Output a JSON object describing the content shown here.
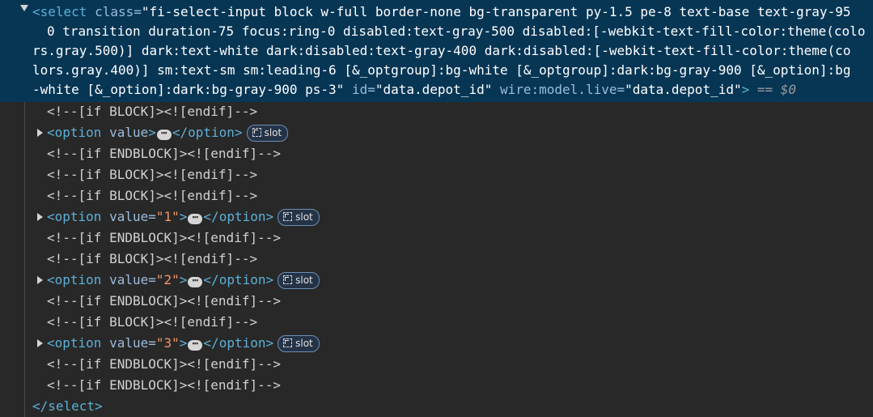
{
  "select_element": {
    "open_tag": "<select",
    "class_attr": " class=",
    "class_lines": [
      "\"fi-select-input block w-full border-none bg-transparent py-1.5 pe-8 text-base text-gray-95",
      "0 transition duration-75 focus:ring-0 disabled:text-gray-500 disabled:[-webkit-text-fill-color:theme(colo",
      "rs.gray.500)] dark:text-white dark:disabled:text-gray-400 dark:disabled:[-webkit-text-fill-color:theme(co",
      "lors.gray.400)] sm:text-sm sm:leading-6 [&_optgroup]:bg-white [&_optgroup]:dark:bg-gray-900 [&_option]:bg",
      "-white [&_option]:dark:bg-gray-900 ps-3\""
    ],
    "id_attr": " id=",
    "id_value": "\"data.depot_id\"",
    "wire_attr": " wire:model.live=",
    "wire_value": "\"data.depot_id\"",
    "close_bracket": ">",
    "selected_ref": " == $0",
    "close_tag": "</select>"
  },
  "comments": {
    "if_block": "<!--[if BLOCK]><![endif]-->",
    "if_endblock": "<!--[if ENDBLOCK]><![endif]-->"
  },
  "option_nodes": [
    {
      "open": "<option",
      "attr": " value",
      "value": "",
      "close": ">",
      "end": "</option>",
      "slot": "slot"
    },
    {
      "open": "<option",
      "attr": " value=",
      "value": "\"1\"",
      "close": ">",
      "end": "</option>",
      "slot": "slot"
    },
    {
      "open": "<option",
      "attr": " value=",
      "value": "\"2\"",
      "close": ">",
      "end": "</option>",
      "slot": "slot"
    },
    {
      "open": "<option",
      "attr": " value=",
      "value": "\"3\"",
      "close": ">",
      "end": "</option>",
      "slot": "slot"
    }
  ],
  "ellipsis": "⋯",
  "colors": {
    "background": "#282828",
    "selection": "#073655",
    "tag": "#5db0d7",
    "attribute": "#9bbbdc",
    "value": "#f29766"
  }
}
